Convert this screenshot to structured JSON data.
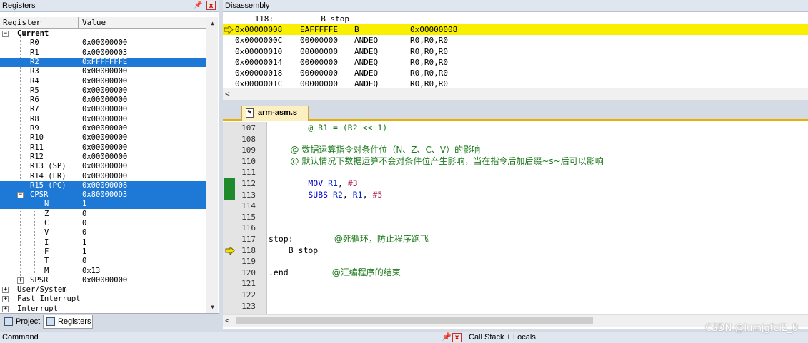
{
  "registers_pane": {
    "title": "Registers",
    "col_register": "Register",
    "col_value": "Value",
    "rows": [
      {
        "name": "Current",
        "value": "",
        "level": 0,
        "toggle": "-",
        "bold": true
      },
      {
        "name": "R0",
        "value": "0x00000000",
        "level": 1
      },
      {
        "name": "R1",
        "value": "0x00000003",
        "level": 1
      },
      {
        "name": "R2",
        "value": "0xFFFFFFFE",
        "level": 1,
        "selected": true
      },
      {
        "name": "R3",
        "value": "0x00000000",
        "level": 1
      },
      {
        "name": "R4",
        "value": "0x00000000",
        "level": 1
      },
      {
        "name": "R5",
        "value": "0x00000000",
        "level": 1
      },
      {
        "name": "R6",
        "value": "0x00000000",
        "level": 1
      },
      {
        "name": "R7",
        "value": "0x00000000",
        "level": 1
      },
      {
        "name": "R8",
        "value": "0x00000000",
        "level": 1
      },
      {
        "name": "R9",
        "value": "0x00000000",
        "level": 1
      },
      {
        "name": "R10",
        "value": "0x00000000",
        "level": 1
      },
      {
        "name": "R11",
        "value": "0x00000000",
        "level": 1
      },
      {
        "name": "R12",
        "value": "0x00000000",
        "level": 1
      },
      {
        "name": "R13 (SP)",
        "value": "0x00000000",
        "level": 1
      },
      {
        "name": "R14 (LR)",
        "value": "0x00000000",
        "level": 1
      },
      {
        "name": "R15 (PC)",
        "value": "0x00000008",
        "level": 1,
        "selected": true
      },
      {
        "name": "CPSR",
        "value": "0x800000D3",
        "level": 1,
        "toggle": "-",
        "selected": true
      },
      {
        "name": "N",
        "value": "1",
        "level": 2,
        "selected": true
      },
      {
        "name": "Z",
        "value": "0",
        "level": 2
      },
      {
        "name": "C",
        "value": "0",
        "level": 2
      },
      {
        "name": "V",
        "value": "0",
        "level": 2
      },
      {
        "name": "I",
        "value": "1",
        "level": 2
      },
      {
        "name": "F",
        "value": "1",
        "level": 2
      },
      {
        "name": "T",
        "value": "0",
        "level": 2
      },
      {
        "name": "M",
        "value": "0x13",
        "level": 2
      },
      {
        "name": "SPSR",
        "value": "0x00000000",
        "level": 1,
        "toggle": "+"
      },
      {
        "name": "User/System",
        "value": "",
        "level": 0,
        "toggle": "+"
      },
      {
        "name": "Fast Interrupt",
        "value": "",
        "level": 0,
        "toggle": "+"
      },
      {
        "name": "Interrupt",
        "value": "",
        "level": 0,
        "toggle": "+"
      }
    ],
    "tabs": {
      "project": "Project",
      "registers": "Registers"
    }
  },
  "disassembly_pane": {
    "title": "Disassembly",
    "source_line": "    118:          B stop",
    "rows": [
      {
        "addr": "0x00000008",
        "code": "EAFFFFFE",
        "op": "B",
        "args": "0x00000008",
        "current": true
      },
      {
        "addr": "0x0000000C",
        "code": "00000000",
        "op": "ANDEQ",
        "args": "R0,R0,R0"
      },
      {
        "addr": "0x00000010",
        "code": "00000000",
        "op": "ANDEQ",
        "args": "R0,R0,R0"
      },
      {
        "addr": "0x00000014",
        "code": "00000000",
        "op": "ANDEQ",
        "args": "R0,R0,R0"
      },
      {
        "addr": "0x00000018",
        "code": "00000000",
        "op": "ANDEQ",
        "args": "R0,R0,R0"
      },
      {
        "addr": "0x0000001C",
        "code": "00000000",
        "op": "ANDEQ",
        "args": "R0,R0,R0"
      }
    ]
  },
  "editor": {
    "tab_label": "arm-asm.s",
    "lines": [
      {
        "num": "107",
        "segments": [
          {
            "t": "        @ R1 = (R2 << 1)",
            "c": "cmt"
          }
        ]
      },
      {
        "num": "108",
        "segments": []
      },
      {
        "num": "109",
        "segments": [
          {
            "t": "        @ 数据运算指令对条件位（N、Z、C、V）的影响",
            "c": "cmt"
          }
        ]
      },
      {
        "num": "110",
        "segments": [
          {
            "t": "        @ 默认情况下数据运算不会对条件位产生影响，当在指令后加后缀~s~后可以影响",
            "c": "cmt"
          }
        ]
      },
      {
        "num": "111",
        "segments": []
      },
      {
        "num": "112",
        "segments": [
          {
            "t": "        MOV ",
            "c": "kw"
          },
          {
            "t": "R1",
            "c": "reg"
          },
          {
            "t": ", ",
            "c": ""
          },
          {
            "t": "#3",
            "c": "num"
          }
        ]
      },
      {
        "num": "113",
        "segments": [
          {
            "t": "        SUBS ",
            "c": "kw"
          },
          {
            "t": "R2",
            "c": "reg"
          },
          {
            "t": ", ",
            "c": ""
          },
          {
            "t": "R1",
            "c": "reg"
          },
          {
            "t": ", ",
            "c": ""
          },
          {
            "t": "#5",
            "c": "num"
          }
        ]
      },
      {
        "num": "114",
        "segments": []
      },
      {
        "num": "115",
        "segments": []
      },
      {
        "num": "116",
        "segments": []
      },
      {
        "num": "117",
        "segments": [
          {
            "t": "stop:",
            "c": ""
          },
          {
            "t": "               @死循环，防止程序跑飞",
            "c": "cmt"
          }
        ]
      },
      {
        "num": "118",
        "segments": [
          {
            "t": "    B stop",
            "c": ""
          }
        ]
      },
      {
        "num": "119",
        "segments": []
      },
      {
        "num": "120",
        "segments": [
          {
            "t": ".end",
            "c": ""
          },
          {
            "t": "                @汇编程序的结束",
            "c": "cmt"
          }
        ]
      },
      {
        "num": "121",
        "segments": []
      },
      {
        "num": "122",
        "segments": []
      },
      {
        "num": "123",
        "segments": []
      }
    ],
    "arrow_line": "118",
    "marked_lines": [
      "112",
      "113"
    ]
  },
  "bottom": {
    "command_label": "Command",
    "callstack_label": "Call Stack + Locals"
  },
  "watermark": "CSDN @lumjgfei2_0",
  "colors": {
    "selection": "#1e78d6",
    "current_line": "#f8f000",
    "breakpoint_mark": "#1f8a2c"
  }
}
